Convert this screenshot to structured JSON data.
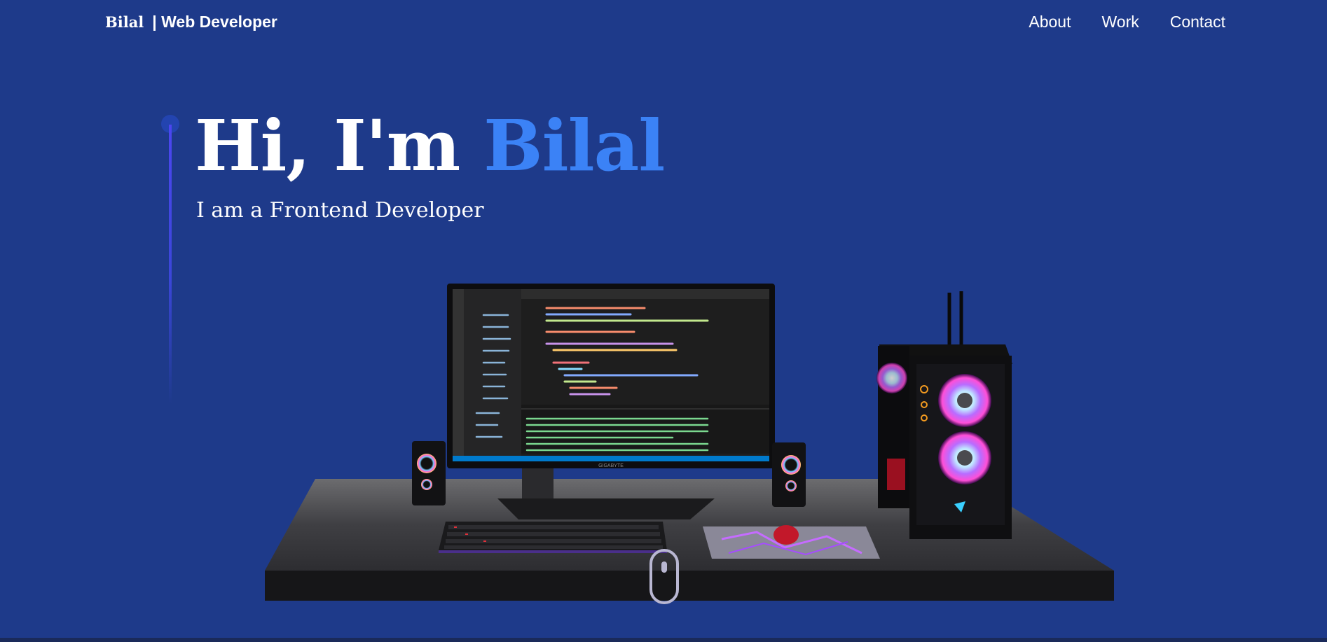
{
  "nav": {
    "brand_name": "Bilal",
    "brand_role": "| Web Developer",
    "links": [
      {
        "label": "About"
      },
      {
        "label": "Work"
      },
      {
        "label": "Contact"
      }
    ]
  },
  "hero": {
    "greeting": "Hi, I'm ",
    "name": "Bilal",
    "subtitle": "I am a Frontend Developer"
  },
  "scene": {
    "monitor_brand": "GIGABYTE"
  },
  "colors": {
    "background": "#1e3a8a",
    "accent": "#3b82f6",
    "timeline": "#4c46f0"
  }
}
